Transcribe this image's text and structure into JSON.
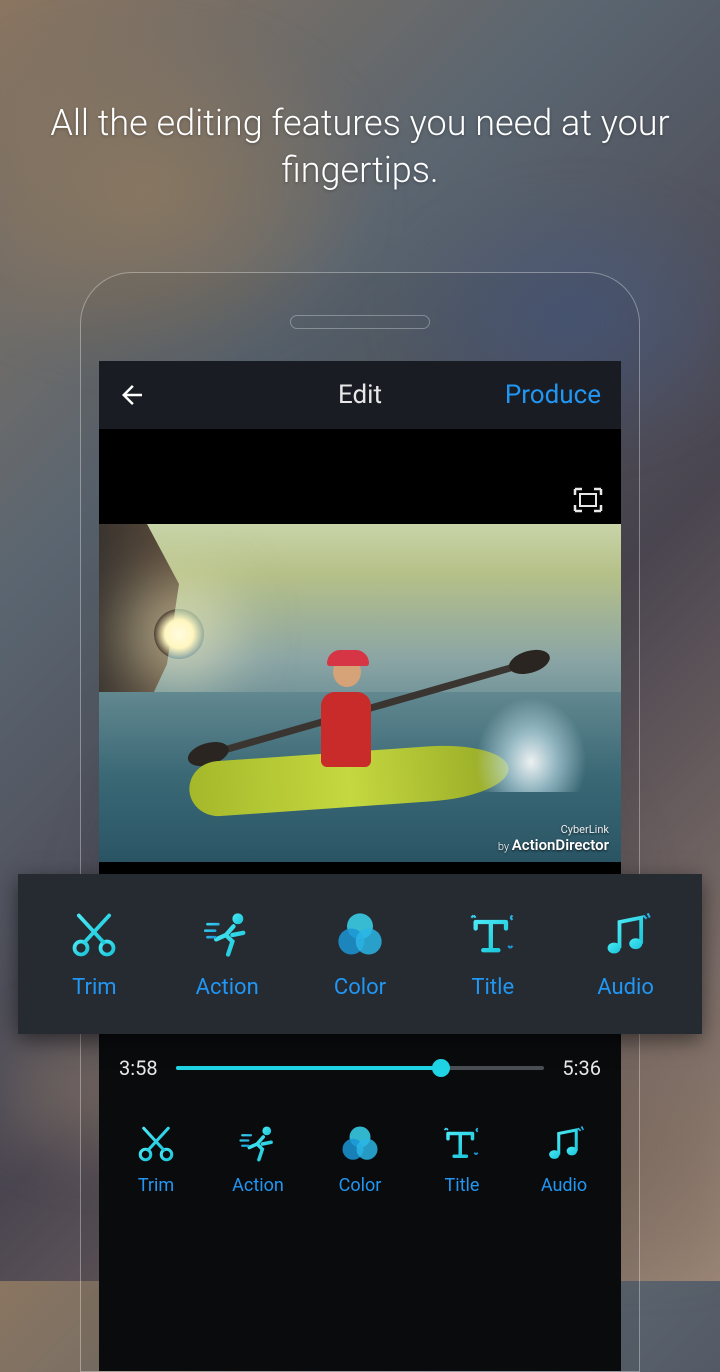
{
  "headline": "All the editing features you need at your fingertips.",
  "titlebar": {
    "title": "Edit",
    "produce": "Produce"
  },
  "watermark": {
    "line1": "CyberLink",
    "by": "by ",
    "brand": "ActionDirector"
  },
  "timeline": {
    "current": "3:58",
    "total": "5:36"
  },
  "tools": [
    {
      "label": "Trim"
    },
    {
      "label": "Action"
    },
    {
      "label": "Color"
    },
    {
      "label": "Title"
    },
    {
      "label": "Audio"
    }
  ],
  "colors": {
    "accent": "#2196f3",
    "cyan": "#1fd5e5"
  }
}
